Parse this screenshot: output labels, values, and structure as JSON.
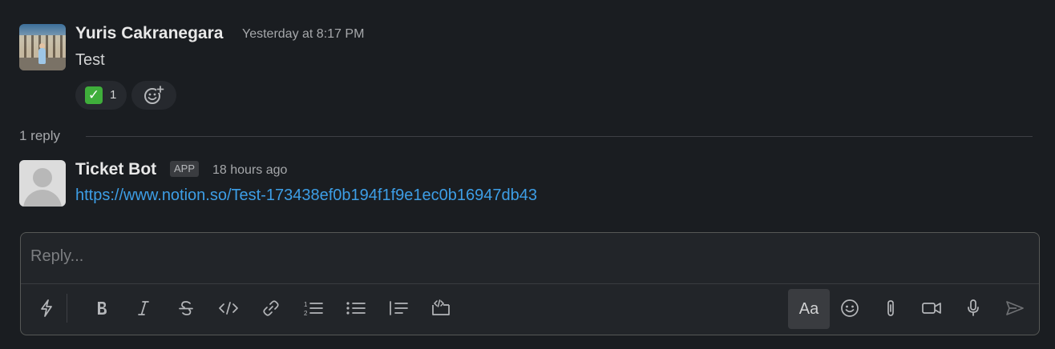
{
  "message": {
    "author": "Yuris Cakranegara",
    "timestamp": "Yesterday at 8:17 PM",
    "text": "Test",
    "reaction": {
      "emoji": "✓",
      "count": "1"
    }
  },
  "thread": {
    "reply_count_label": "1 reply"
  },
  "reply": {
    "author": "Ticket Bot",
    "badge": "APP",
    "timestamp": "18 hours ago",
    "link": "https://www.notion.so/Test-173438ef0b194f1f9e1ec0b16947db43"
  },
  "composer": {
    "placeholder": "Reply...",
    "format_button_label": "Aa"
  },
  "icons": {
    "reaction_emoji": "white-check-mark",
    "add_reaction": "add-reaction-icon"
  },
  "colors": {
    "background": "#1a1d21",
    "link": "#3d9ee6",
    "check_green": "#3fae3b"
  }
}
